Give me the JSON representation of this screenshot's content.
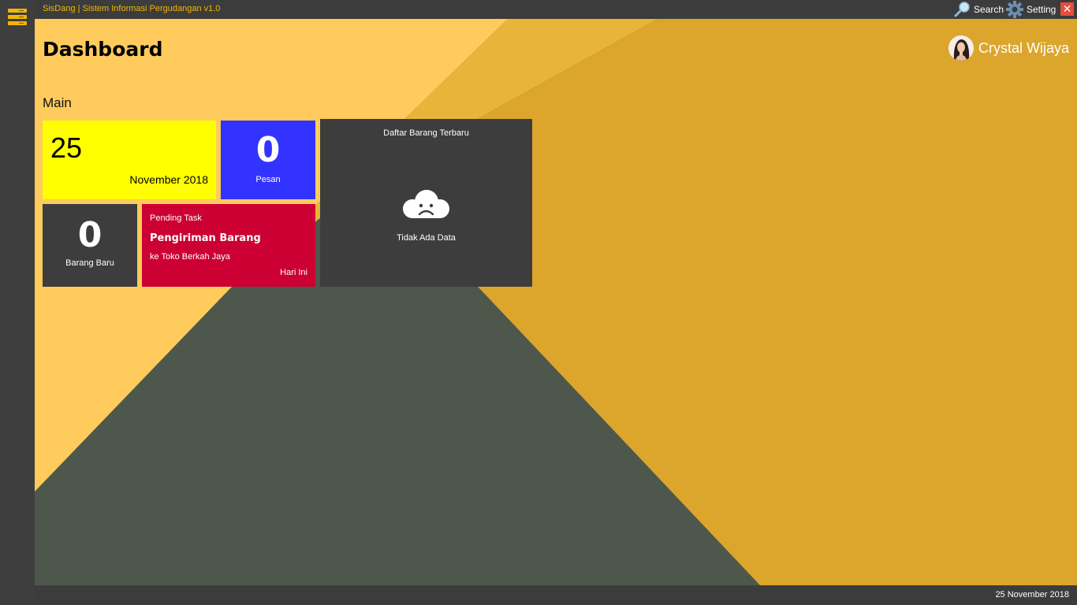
{
  "app": {
    "title": "SisDang | Sistem Informasi Pergudangan v1.0",
    "search_label": "Search",
    "setting_label": "Setting",
    "close_glyph": "✕"
  },
  "header": {
    "page_title": "Dashboard",
    "user_name": "Crystal Wijaya"
  },
  "section": {
    "title": "Main"
  },
  "tiles": {
    "date": {
      "day": "25",
      "month_year": "November 2018"
    },
    "pesan": {
      "count": "0",
      "label": "Pesan"
    },
    "barang": {
      "count": "0",
      "label": "Barang Baru"
    },
    "task": {
      "heading": "Pending Task",
      "title": "Pengiriman Barang",
      "subtitle": "ke Toko Berkah Jaya",
      "when": "Hari Ini"
    },
    "list": {
      "heading": "Daftar Barang Terbaru",
      "empty_text": "Tidak Ada Data"
    }
  },
  "status": {
    "date": "25 November 2018"
  },
  "colors": {
    "accent": "#f2b705",
    "tile_yellow": "#ffff00",
    "tile_blue": "#3333ff",
    "tile_red": "#cc0033",
    "tile_dark": "#3d3d3d"
  },
  "icons": {
    "menu": "hamburger-menu-icon",
    "search": "search-icon",
    "setting": "gear-icon",
    "close": "close-icon",
    "empty": "sad-cloud-icon"
  }
}
